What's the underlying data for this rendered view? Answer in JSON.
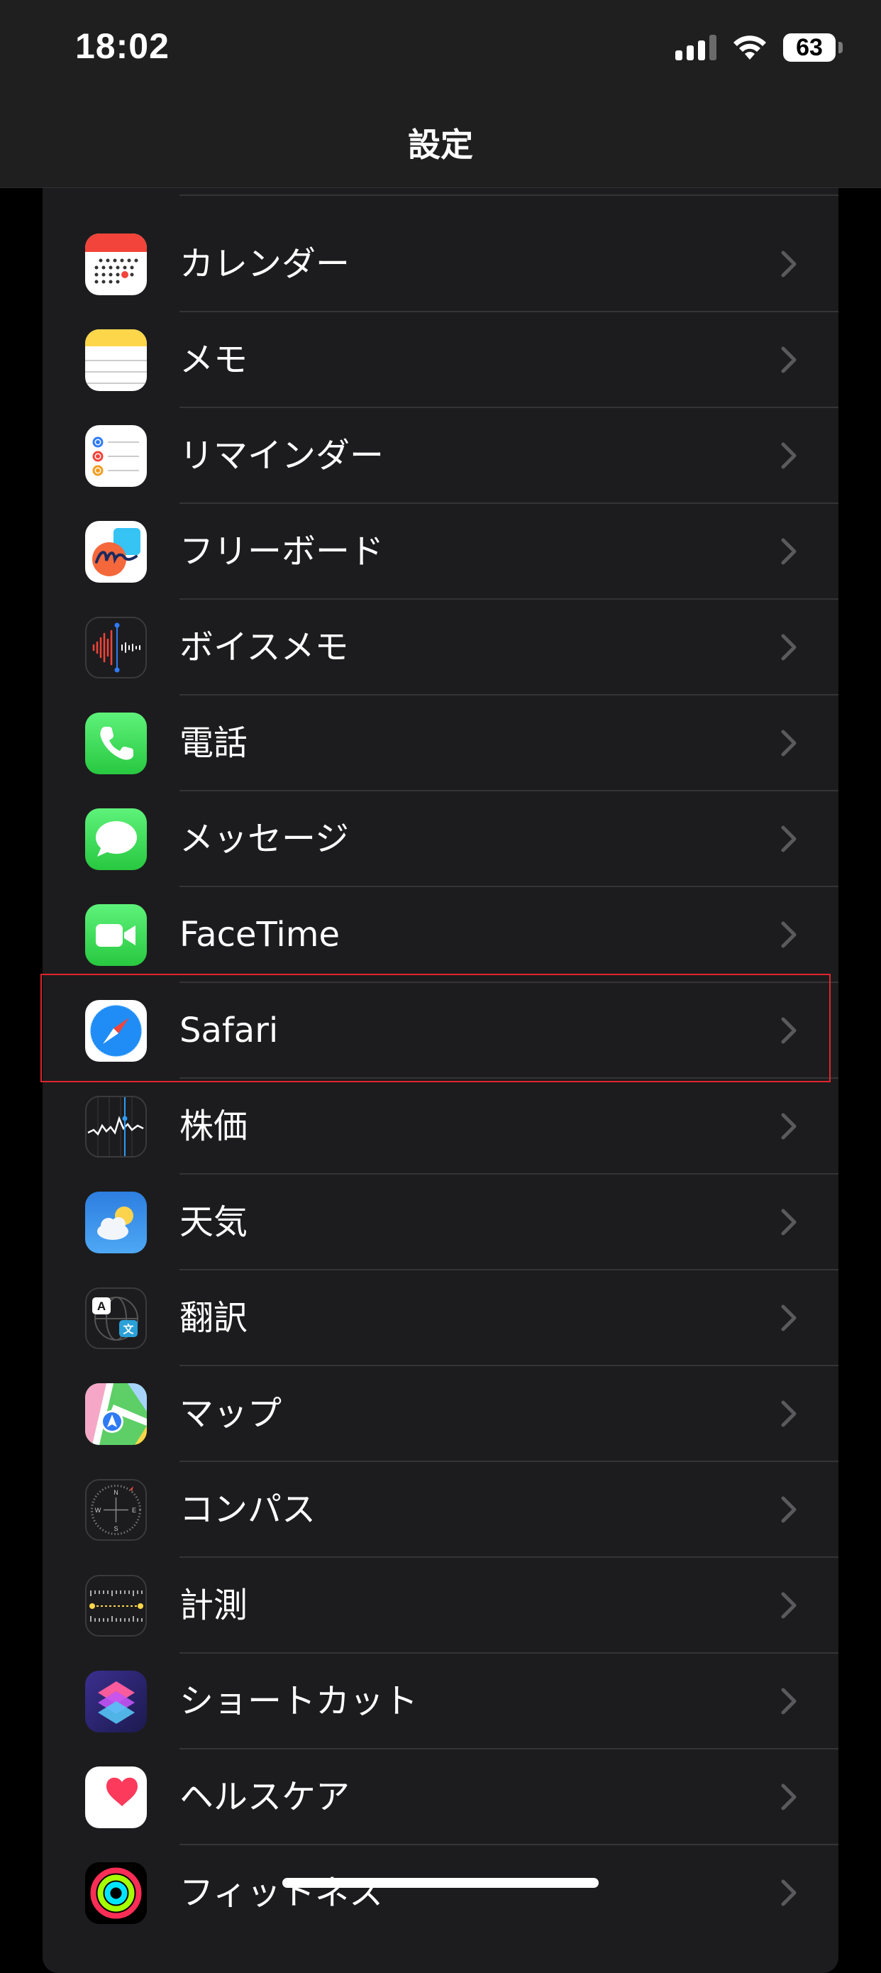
{
  "status_bar": {
    "time": "18:02",
    "battery": "63",
    "icons": [
      "cellular-signal-icon",
      "wifi-icon",
      "battery-icon"
    ]
  },
  "header": {
    "title": "設定"
  },
  "settings": {
    "items": [
      {
        "label": "カレンダー",
        "icon": "calendar-icon"
      },
      {
        "label": "メモ",
        "icon": "notes-icon"
      },
      {
        "label": "リマインダー",
        "icon": "reminders-icon"
      },
      {
        "label": "フリーボード",
        "icon": "freeform-icon"
      },
      {
        "label": "ボイスメモ",
        "icon": "voice-memos-icon"
      },
      {
        "label": "電話",
        "icon": "phone-icon"
      },
      {
        "label": "メッセージ",
        "icon": "messages-icon"
      },
      {
        "label": "FaceTime",
        "icon": "facetime-icon"
      },
      {
        "label": "Safari",
        "icon": "safari-icon"
      },
      {
        "label": "株価",
        "icon": "stocks-icon"
      },
      {
        "label": "天気",
        "icon": "weather-icon"
      },
      {
        "label": "翻訳",
        "icon": "translate-icon"
      },
      {
        "label": "マップ",
        "icon": "maps-icon"
      },
      {
        "label": "コンパス",
        "icon": "compass-icon"
      },
      {
        "label": "計測",
        "icon": "measure-icon"
      },
      {
        "label": "ショートカット",
        "icon": "shortcuts-icon"
      },
      {
        "label": "ヘルスケア",
        "icon": "health-icon"
      },
      {
        "label": "フィットネス",
        "icon": "fitness-icon"
      }
    ],
    "highlighted": "Safari"
  },
  "colors": {
    "background": "#000000",
    "card": "#1c1c1e",
    "separator": "#343436",
    "chevron": "#5a5a5e",
    "highlight": "#e0252b"
  }
}
